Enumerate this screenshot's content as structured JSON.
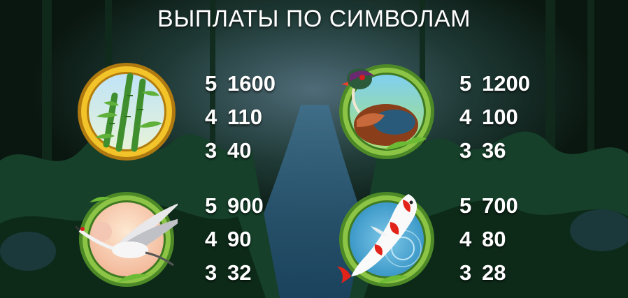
{
  "title": "ВЫПЛАТЫ ПО СИМВОЛАМ",
  "colors": {
    "background": "#0b1a12",
    "text": "#ffffff",
    "gold_ring": "#e6b316",
    "bamboo_ring": "#6fa834"
  },
  "symbols": [
    {
      "icon": "bamboo-icon",
      "payouts": [
        {
          "count": "5",
          "amount": "1600"
        },
        {
          "count": "4",
          "amount": "110"
        },
        {
          "count": "3",
          "amount": "40"
        }
      ]
    },
    {
      "icon": "duck-icon",
      "payouts": [
        {
          "count": "5",
          "amount": "1200"
        },
        {
          "count": "4",
          "amount": "100"
        },
        {
          "count": "3",
          "amount": "36"
        }
      ]
    },
    {
      "icon": "crane-icon",
      "payouts": [
        {
          "count": "5",
          "amount": "900"
        },
        {
          "count": "4",
          "amount": "90"
        },
        {
          "count": "3",
          "amount": "32"
        }
      ]
    },
    {
      "icon": "koi-fish-icon",
      "payouts": [
        {
          "count": "5",
          "amount": "700"
        },
        {
          "count": "4",
          "amount": "80"
        },
        {
          "count": "3",
          "amount": "28"
        }
      ]
    }
  ]
}
